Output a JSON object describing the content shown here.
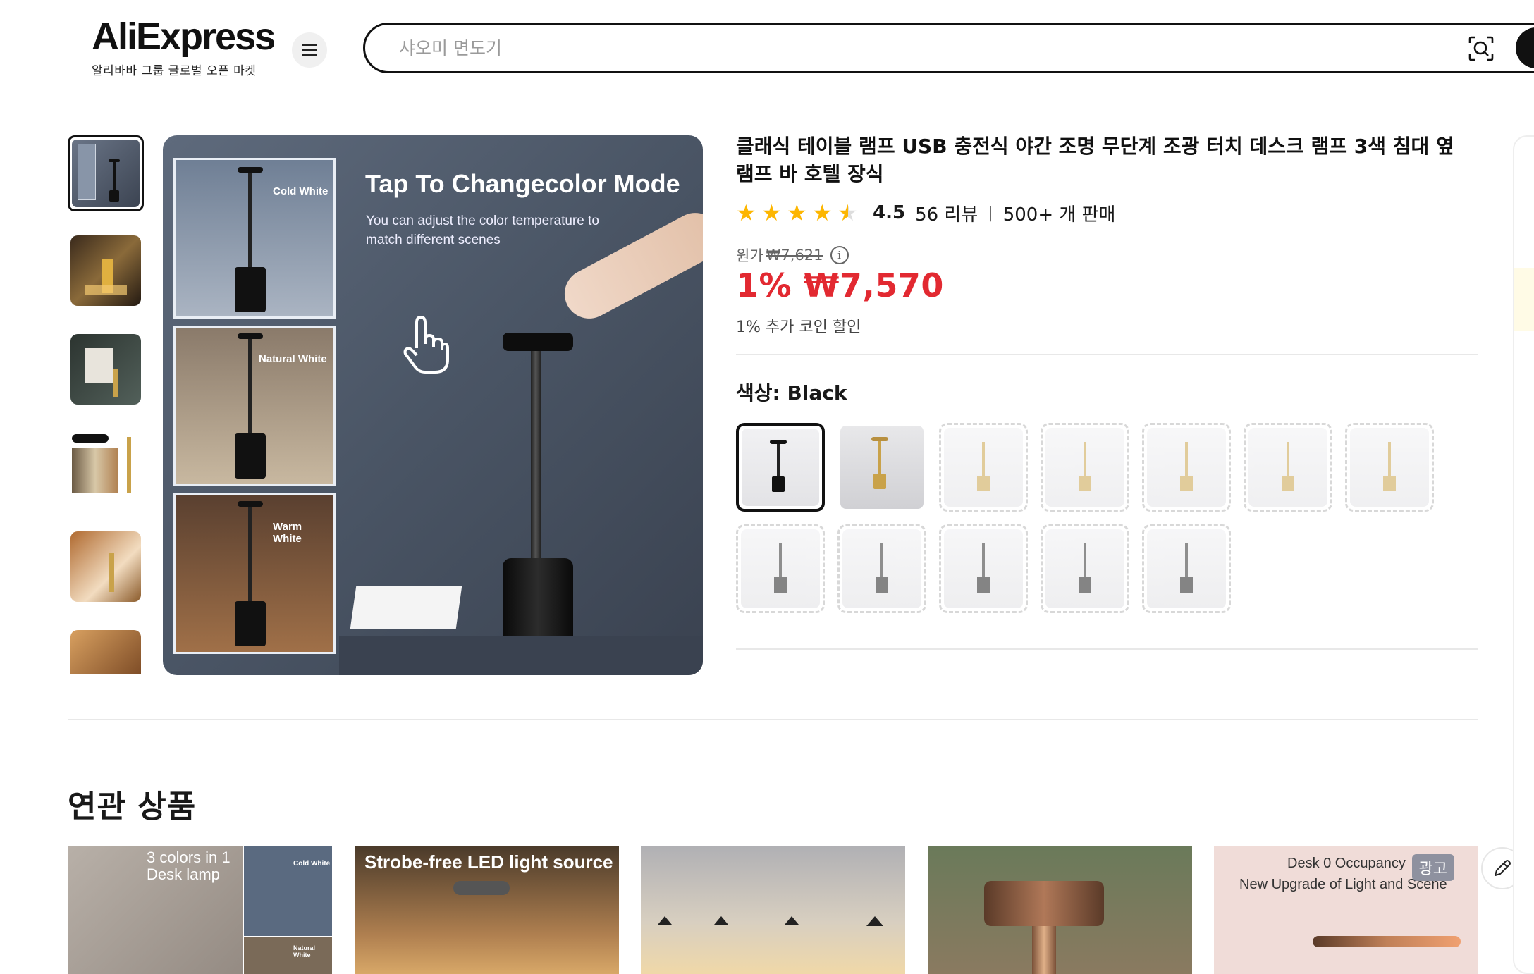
{
  "header": {
    "logo_text": "AliExpress",
    "logo_sub": "알리바바 그룹 글로벌 오픈 마켓",
    "search_placeholder": "샤오미 면도기"
  },
  "gallery": {
    "main_title": "Tap To Changecolor Mode",
    "main_sub": "You can adjust the color temperature to match different scenes",
    "panels": [
      "Cold White",
      "Natural White",
      "Warm White"
    ],
    "thumb_count": 6
  },
  "product": {
    "title": "클래식 테이블 램프 USB 충전식 야간 조명 무단계 조광 터치 데스크 램프 3색 침대 옆 램프 바 호텔 장식",
    "rating": "4.5",
    "rating_value": 4.5,
    "reviews": "56 리뷰",
    "sold": "500+ 개 판매",
    "orig_label": "원가",
    "orig_price": "₩7,621",
    "price": "1% ₩7,570",
    "coin_text": "1% 추가 코인 할인",
    "color_label": "색상: Black",
    "colors": {
      "accent_price": "#e22931",
      "star": "#fdb600"
    }
  },
  "related": {
    "title": "연관 상품",
    "cards": [
      {
        "text1": "3 colors in 1",
        "text2": "Desk lamp",
        "mini": "Cold White",
        "mini2": "Natural White"
      },
      {
        "text1": "Strobe-free LED light source"
      },
      {},
      {},
      {
        "text1": "Desk 0 Occupancy",
        "text2": "New Upgrade of Light and Scene",
        "badge": "광고"
      }
    ]
  },
  "icons": {
    "menu": "hamburger-icon",
    "camera": "image-search-icon",
    "info": "info-icon",
    "edit": "pencil-icon"
  }
}
